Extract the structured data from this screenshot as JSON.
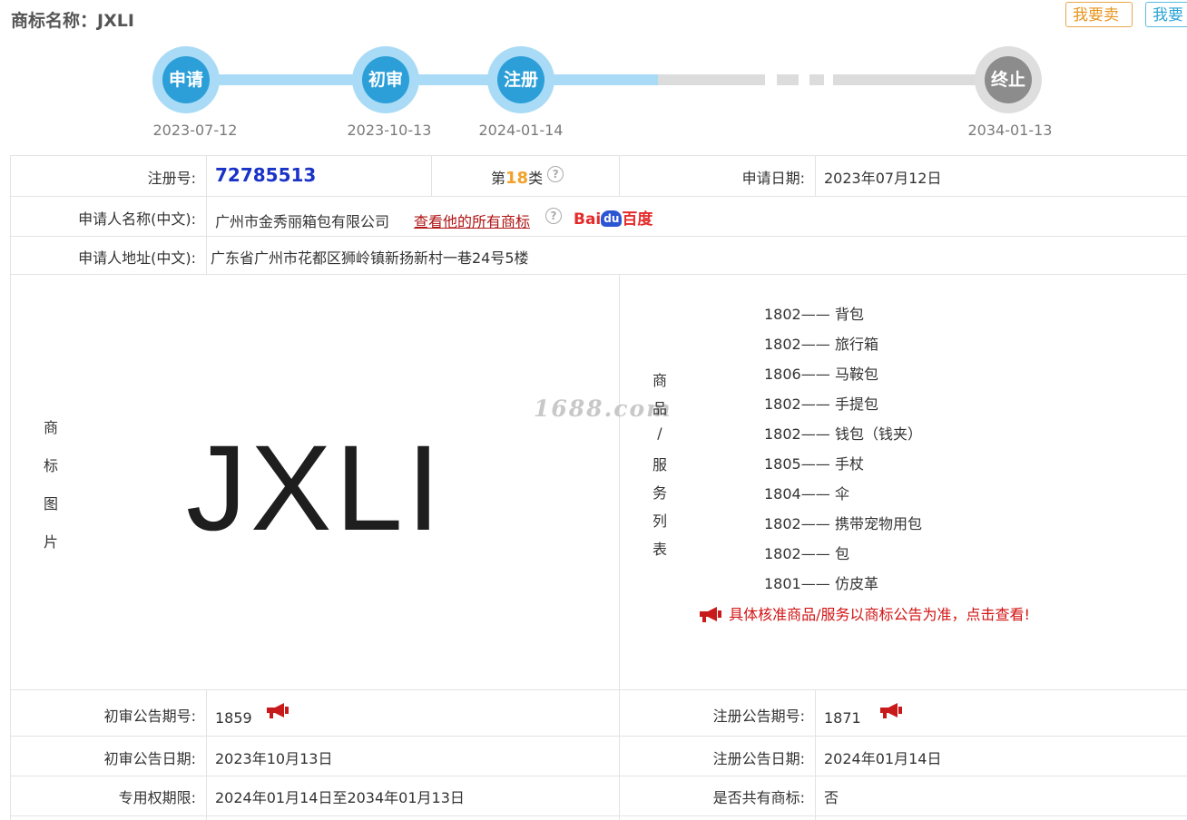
{
  "header": {
    "title": "商标名称：JXLI",
    "sell_label": "我要卖",
    "buy_label": "我要"
  },
  "progress": {
    "steps": [
      {
        "label": "申请",
        "date": "2023-07-12",
        "done": true
      },
      {
        "label": "初审",
        "date": "2023-10-13",
        "done": true
      },
      {
        "label": "注册",
        "date": "2024-01-14",
        "done": true
      },
      {
        "label": "终止",
        "date": "2034-01-13",
        "done": false
      }
    ]
  },
  "colors": {
    "accent": "#2c9fd8",
    "accent_light": "#a9dbf6",
    "link_red": "#b01414",
    "class_orange": "#f2a22a",
    "reg_blue": "#1a33c7"
  },
  "info": {
    "reg_no_label": "注册号:",
    "reg_no": "72785513",
    "class_prefix": "第",
    "class_num": "18",
    "class_suffix": "类",
    "apply_date_label": "申请日期:",
    "apply_date": "2023年07月12日",
    "applicant_label": "申请人名称(中文):",
    "applicant": "广州市金秀丽箱包有限公司",
    "view_all_link": "查看他的所有商标",
    "baidu_text": "Bai",
    "baidu_paw": "du",
    "baidu_cn": "百度",
    "address_label": "申请人地址(中文):",
    "address": "广东省广州市花都区狮岭镇新扬新村一巷24号5楼",
    "mark_image_label": [
      "商",
      "标",
      "图",
      "片"
    ],
    "mark_text": "JXLI",
    "watermark": "1688.com",
    "goods_label": [
      "商",
      "品",
      "/",
      "服",
      "务",
      "列",
      "表"
    ],
    "goods": [
      {
        "code": "1802——",
        "name": "背包"
      },
      {
        "code": "1802——",
        "name": "旅行箱"
      },
      {
        "code": "1806——",
        "name": "马鞍包"
      },
      {
        "code": "1802——",
        "name": "手提包"
      },
      {
        "code": "1802——",
        "name": "钱包（钱夹）"
      },
      {
        "code": "1805——",
        "name": "手杖"
      },
      {
        "code": "1804——",
        "name": "伞"
      },
      {
        "code": "1802——",
        "name": "携带宠物用包"
      },
      {
        "code": "1802——",
        "name": "包"
      },
      {
        "code": "1801——",
        "name": "仿皮革"
      }
    ],
    "goods_notice": "具体核准商品/服务以商标公告为准，点击查看!",
    "prelim_issue_label": "初审公告期号:",
    "prelim_issue": "1859",
    "reg_issue_label": "注册公告期号:",
    "reg_issue": "1871",
    "prelim_date_label": "初审公告日期:",
    "prelim_date": "2023年10月13日",
    "reg_date_label": "注册公告日期:",
    "reg_date": "2024年01月14日",
    "exclusive_label": "专用权期限:",
    "exclusive": "2024年01月14日至2034年01月13日",
    "shared_label": "是否共有商标:",
    "shared": "否"
  }
}
